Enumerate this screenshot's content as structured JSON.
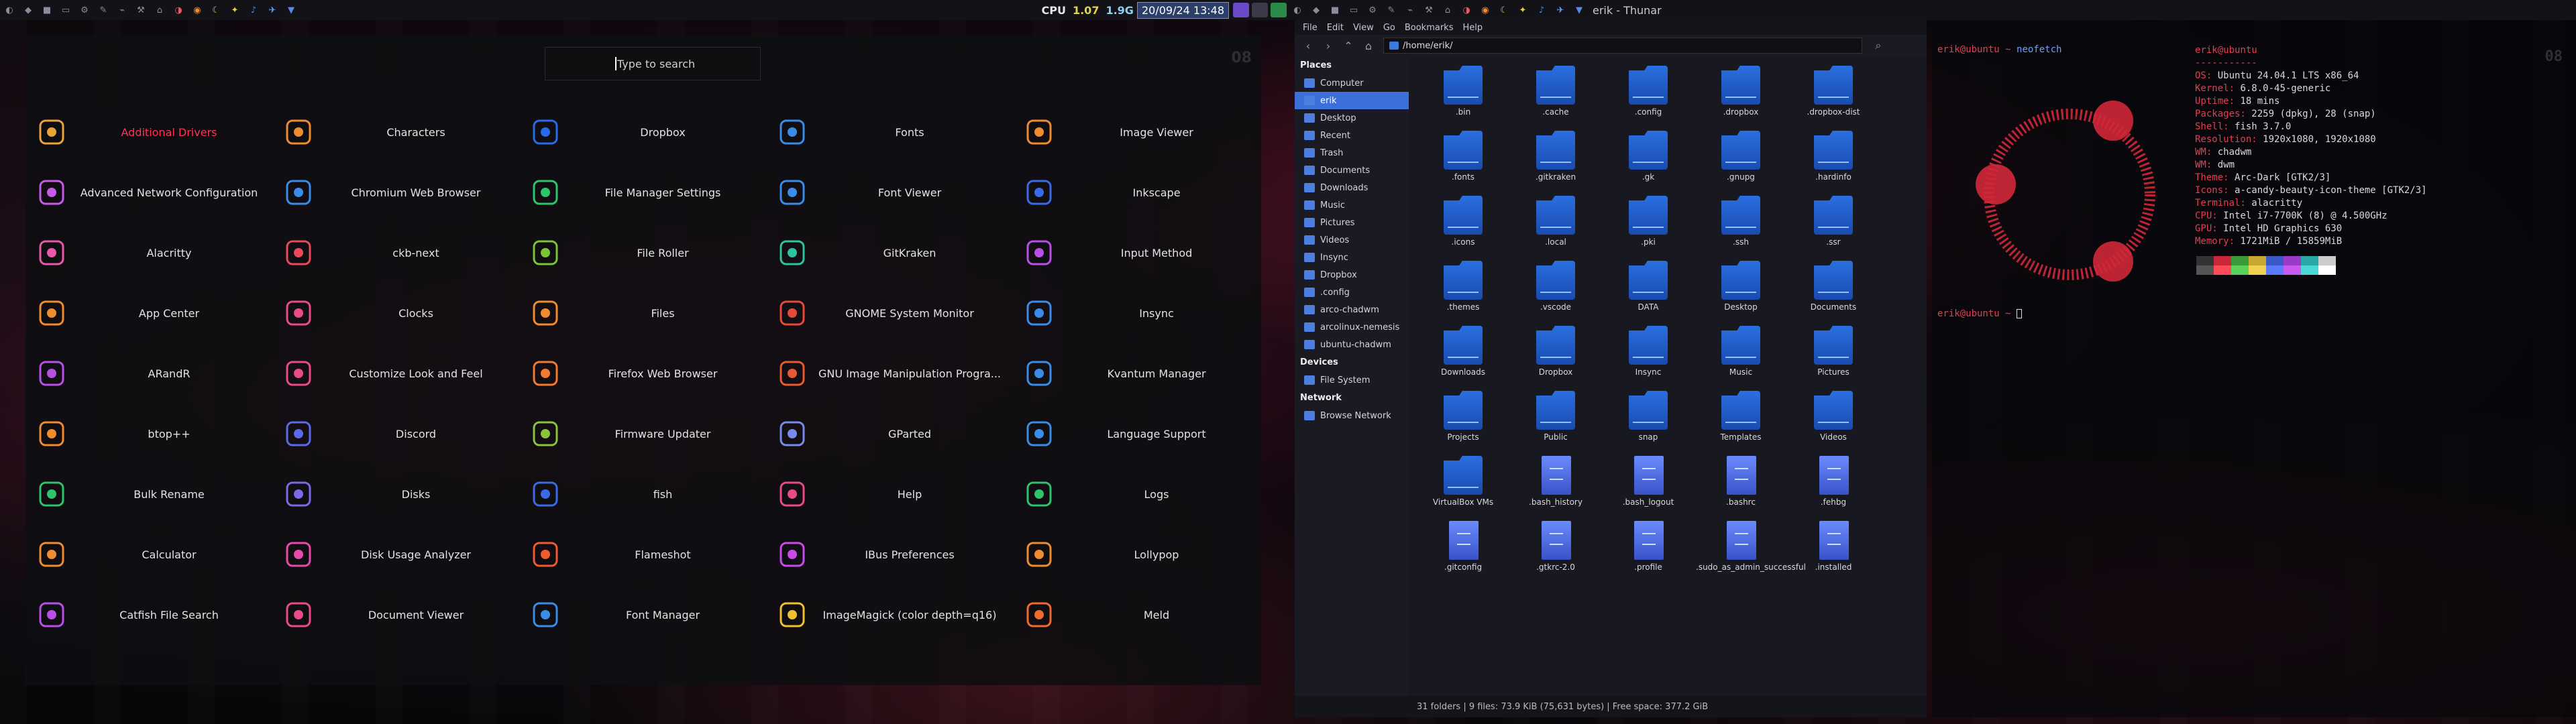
{
  "status": {
    "cpu_label": "CPU",
    "cpu_value": "1.07",
    "mem": "1.9G",
    "datetime": "20/09/24 13:48"
  },
  "thunar_title": "erik - Thunar",
  "launcher": {
    "search_placeholder": "Type to search",
    "workspace_number": "08",
    "apps": [
      {
        "label": "Additional Drivers",
        "icon": "drivers-icon",
        "color": "#e8a33a"
      },
      {
        "label": "Advanced Network Configuration",
        "icon": "globe-icon",
        "color": "#c85ae8"
      },
      {
        "label": "Alacritty",
        "icon": "terminal-icon",
        "color": "#e85aa8"
      },
      {
        "label": "App Center",
        "icon": "app-center-icon",
        "color": "#f08c30"
      },
      {
        "label": "ARandR",
        "icon": "monitor-icon",
        "color": "#b850e8"
      },
      {
        "label": "btop++",
        "icon": "btop-icon",
        "color": "#f08c30"
      },
      {
        "label": "Bulk Rename",
        "icon": "bulk-rename-icon",
        "color": "#2ec46a"
      },
      {
        "label": "Calculator",
        "icon": "calculator-icon",
        "color": "#f08c30"
      },
      {
        "label": "Catfish File Search",
        "icon": "catfish-icon",
        "color": "#b850e8"
      },
      {
        "label": "Characters",
        "icon": "characters-icon",
        "color": "#f08c30"
      },
      {
        "label": "Chromium Web Browser",
        "icon": "chromium-icon",
        "color": "#3a8ce8"
      },
      {
        "label": "ckb-next",
        "icon": "ckb-icon",
        "color": "#e84a5a"
      },
      {
        "label": "Clocks",
        "icon": "clock-icon",
        "color": "#e84a8a"
      },
      {
        "label": "Customize Look and Feel",
        "icon": "brush-icon",
        "color": "#e84a8a"
      },
      {
        "label": "Discord",
        "icon": "discord-icon",
        "color": "#5a6ae8"
      },
      {
        "label": "Disks",
        "icon": "disks-icon",
        "color": "#7a6ae8"
      },
      {
        "label": "Disk Usage Analyzer",
        "icon": "disk-usage-icon",
        "color": "#e84aa8"
      },
      {
        "label": "Document Viewer",
        "icon": "document-viewer-icon",
        "color": "#e84a8a"
      },
      {
        "label": "Dropbox",
        "icon": "dropbox-icon",
        "color": "#2a6ae8"
      },
      {
        "label": "File Manager Settings",
        "icon": "folder-settings-icon",
        "color": "#2ec46a"
      },
      {
        "label": "File Roller",
        "icon": "file-roller-icon",
        "color": "#7ac43a"
      },
      {
        "label": "Files",
        "icon": "folder-icon",
        "color": "#f08c30"
      },
      {
        "label": "Firefox Web Browser",
        "icon": "firefox-icon",
        "color": "#f07a30"
      },
      {
        "label": "Firmware Updater",
        "icon": "firmware-icon",
        "color": "#8ac43a"
      },
      {
        "label": "fish",
        "icon": "fish-icon",
        "color": "#3a6ae8"
      },
      {
        "label": "Flameshot",
        "icon": "flameshot-icon",
        "color": "#f05a30"
      },
      {
        "label": "Font Manager",
        "icon": "font-manager-icon",
        "color": "#3a8ce8"
      },
      {
        "label": "Fonts",
        "icon": "fonts-icon",
        "color": "#3a8ce8"
      },
      {
        "label": "Font Viewer",
        "icon": "font-viewer-icon",
        "color": "#3a8ce8"
      },
      {
        "label": "GitKraken",
        "icon": "gitkraken-icon",
        "color": "#2ec4a0"
      },
      {
        "label": "GNOME System Monitor",
        "icon": "system-monitor-icon",
        "color": "#e84a3a"
      },
      {
        "label": "GNU Image Manipulation Progra...",
        "icon": "gimp-icon",
        "color": "#e85a30"
      },
      {
        "label": "GParted",
        "icon": "gparted-icon",
        "color": "#7a8ae8"
      },
      {
        "label": "Help",
        "icon": "help-icon",
        "color": "#e84a8a"
      },
      {
        "label": "IBus Preferences",
        "icon": "ibus-icon",
        "color": "#c84ae8"
      },
      {
        "label": "ImageMagick (color depth=q16)",
        "icon": "imagemagick-icon",
        "color": "#f0c030"
      },
      {
        "label": "Image Viewer",
        "icon": "image-viewer-icon",
        "color": "#f08c30"
      },
      {
        "label": "Inkscape",
        "icon": "inkscape-icon",
        "color": "#3a6ae8"
      },
      {
        "label": "Input Method",
        "icon": "keyboard-icon",
        "color": "#b850e8"
      },
      {
        "label": "Insync",
        "icon": "cloud-icon",
        "color": "#3a8ce8"
      },
      {
        "label": "Kvantum Manager",
        "icon": "kvantum-icon",
        "color": "#3a8ce8"
      },
      {
        "label": "Language Support",
        "icon": "language-icon",
        "color": "#3a8ce8"
      },
      {
        "label": "Logs",
        "icon": "logs-icon",
        "color": "#2ec46a"
      },
      {
        "label": "Lollypop",
        "icon": "lollypop-icon",
        "color": "#f08c30"
      },
      {
        "label": "Meld",
        "icon": "meld-icon",
        "color": "#f06a30"
      }
    ]
  },
  "thunar": {
    "menu": [
      "File",
      "Edit",
      "View",
      "Go",
      "Bookmarks",
      "Help"
    ],
    "path": "/home/erik/",
    "places_header": "Places",
    "places": [
      "Computer",
      "erik",
      "Desktop",
      "Recent",
      "Trash",
      "Documents",
      "Downloads",
      "Music",
      "Pictures",
      "Videos",
      "Insync",
      "Dropbox",
      ".config",
      "arco-chadwm",
      "arcolinux-nemesis",
      "ubuntu-chadwm"
    ],
    "devices_header": "Devices",
    "devices": [
      "File System"
    ],
    "network_header": "Network",
    "network": [
      "Browse Network"
    ],
    "items": [
      {
        "name": ".bin",
        "type": "folder"
      },
      {
        "name": ".cache",
        "type": "folder"
      },
      {
        "name": ".config",
        "type": "folder"
      },
      {
        "name": ".dropbox",
        "type": "folder"
      },
      {
        "name": ".dropbox-dist",
        "type": "folder"
      },
      {
        "name": ".fonts",
        "type": "folder"
      },
      {
        "name": ".gitkraken",
        "type": "folder"
      },
      {
        "name": ".gk",
        "type": "folder"
      },
      {
        "name": ".gnupg",
        "type": "folder"
      },
      {
        "name": ".hardinfo",
        "type": "folder"
      },
      {
        "name": ".icons",
        "type": "folder"
      },
      {
        "name": ".local",
        "type": "folder"
      },
      {
        "name": ".pki",
        "type": "folder"
      },
      {
        "name": ".ssh",
        "type": "folder"
      },
      {
        "name": ".ssr",
        "type": "folder"
      },
      {
        "name": ".themes",
        "type": "folder"
      },
      {
        "name": ".vscode",
        "type": "folder"
      },
      {
        "name": "DATA",
        "type": "folder"
      },
      {
        "name": "Desktop",
        "type": "folder"
      },
      {
        "name": "Documents",
        "type": "folder"
      },
      {
        "name": "Downloads",
        "type": "folder"
      },
      {
        "name": "Dropbox",
        "type": "folder"
      },
      {
        "name": "Insync",
        "type": "folder"
      },
      {
        "name": "Music",
        "type": "folder"
      },
      {
        "name": "Pictures",
        "type": "folder"
      },
      {
        "name": "Projects",
        "type": "folder"
      },
      {
        "name": "Public",
        "type": "folder"
      },
      {
        "name": "snap",
        "type": "folder"
      },
      {
        "name": "Templates",
        "type": "folder"
      },
      {
        "name": "Videos",
        "type": "folder"
      },
      {
        "name": "VirtualBox VMs",
        "type": "folder"
      },
      {
        "name": ".bash_history",
        "type": "file"
      },
      {
        "name": ".bash_logout",
        "type": "file"
      },
      {
        "name": ".bashrc",
        "type": "file"
      },
      {
        "name": ".fehbg",
        "type": "file"
      },
      {
        "name": ".gitconfig",
        "type": "file"
      },
      {
        "name": ".gtkrc-2.0",
        "type": "file"
      },
      {
        "name": ".profile",
        "type": "file"
      },
      {
        "name": ".sudo_as_admin_successful",
        "type": "file"
      },
      {
        "name": ".installed",
        "type": "file"
      }
    ],
    "status": "31 folders  |  9 files: 73.9 KiB (75,631 bytes)  |  Free space: 377.2 GiB"
  },
  "terminal": {
    "prompt1": "erik@ubuntu ~ ",
    "cmd1": "neofetch",
    "prompt2": "erik@ubuntu ~ ",
    "neofetch": [
      {
        "k": "erik@ubuntu",
        "v": ""
      },
      {
        "k": "-----------",
        "v": ""
      },
      {
        "k": "OS:",
        "v": "Ubuntu 24.04.1 LTS x86_64"
      },
      {
        "k": "Kernel:",
        "v": "6.8.0-45-generic"
      },
      {
        "k": "Uptime:",
        "v": "18 mins"
      },
      {
        "k": "Packages:",
        "v": "2259 (dpkg), 28 (snap)"
      },
      {
        "k": "Shell:",
        "v": "fish 3.7.0"
      },
      {
        "k": "Resolution:",
        "v": "1920x1080, 1920x1080"
      },
      {
        "k": "WM:",
        "v": "chadwm"
      },
      {
        "k": "WM:",
        "v": "dwm"
      },
      {
        "k": "Theme:",
        "v": "Arc-Dark [GTK2/3]"
      },
      {
        "k": "Icons:",
        "v": "a-candy-beauty-icon-theme [GTK2/3]"
      },
      {
        "k": "Terminal:",
        "v": "alacritty"
      },
      {
        "k": "CPU:",
        "v": "Intel i7-7700K (8) @ 4.500GHz"
      },
      {
        "k": "GPU:",
        "v": "Intel HD Graphics 630"
      },
      {
        "k": "Memory:",
        "v": "1721MiB / 15859MiB"
      }
    ],
    "palette": [
      "#333333",
      "#c8283a",
      "#3a9a3a",
      "#c8a830",
      "#3a58c8",
      "#9a3ac8",
      "#2aa8a8",
      "#cccccc",
      "#555555",
      "#ff4a5a",
      "#5ad25a",
      "#f0d050",
      "#5a7aff",
      "#c85af0",
      "#4ad8d8",
      "#ffffff"
    ],
    "workspace_number": "08"
  }
}
